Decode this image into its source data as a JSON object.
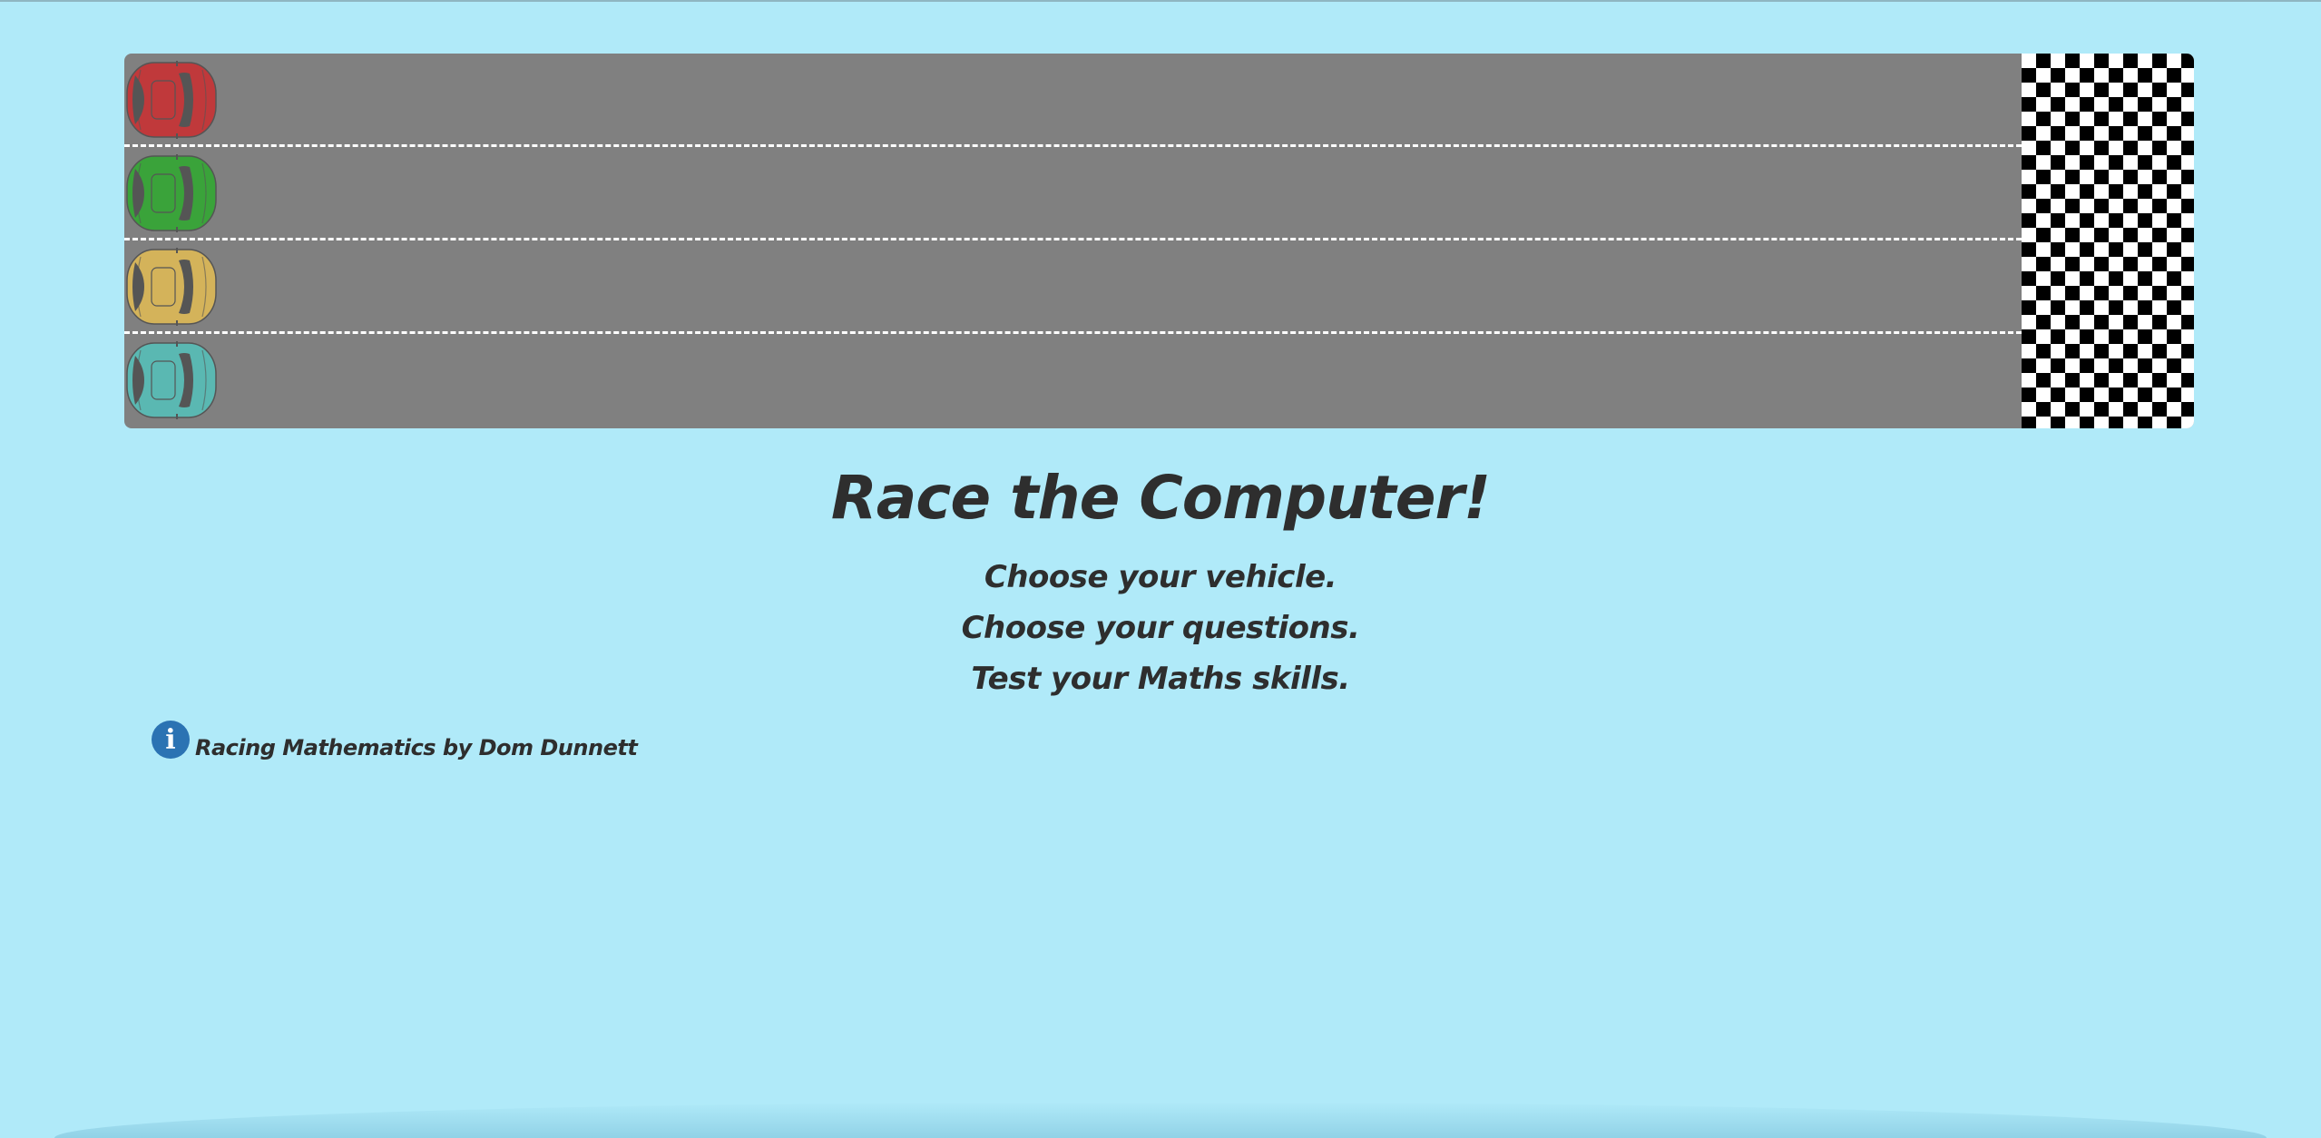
{
  "game": {
    "title": "Race the Computer!",
    "taglines": [
      "Choose your vehicle.",
      "Choose your questions.",
      "Test your Maths skills."
    ],
    "credit": "Racing Mathematics by Dom Dunnett",
    "info_icon_glyph": "i"
  },
  "track": {
    "lanes": 4,
    "road_color": "#808080",
    "finish_line": "checkered-flag-pattern"
  },
  "cars": [
    {
      "name": "red-car",
      "color": "#c0393b"
    },
    {
      "name": "green-car",
      "color": "#3aa33a"
    },
    {
      "name": "yellow-car",
      "color": "#d4b35a"
    },
    {
      "name": "teal-car",
      "color": "#5ab8b2"
    }
  ],
  "colors": {
    "background": "#b0eaf9",
    "text": "#2e2e2e",
    "info_icon": "#2b73b3"
  }
}
